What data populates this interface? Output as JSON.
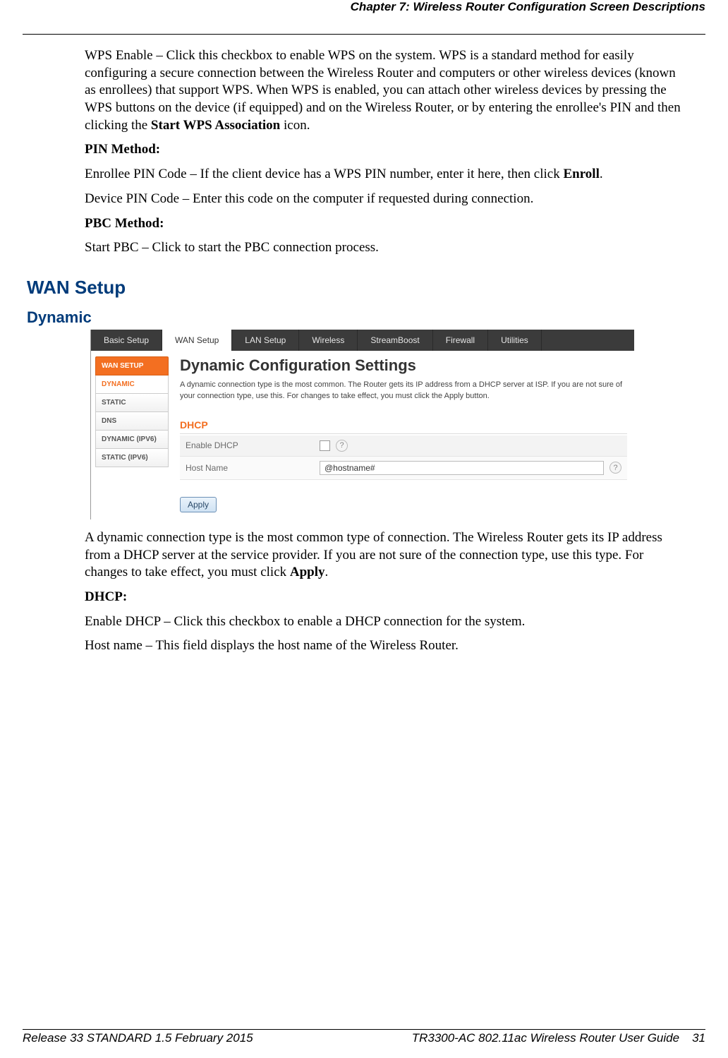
{
  "header": {
    "chapter_line": "Chapter 7: Wireless Router Configuration Screen Descriptions"
  },
  "body": {
    "p1_a": "WPS Enable – Click this checkbox to enable WPS on the system. WPS is a standard method for easily configuring a secure connection between the Wireless Router and computers or other wireless devices (known as enrollees) that support WPS. When WPS is enabled, you can attach other wireless devices by pressing the WPS buttons on the device (if equipped) and on the Wireless Router, or by entering the enrollee's PIN and then clicking the ",
    "p1_bold": "Start WPS Association",
    "p1_b": " icon.",
    "pin_method": "PIN Method:",
    "p2_a": "Enrollee PIN Code – If the client device has a WPS PIN number, enter it here, then click ",
    "p2_bold": "Enroll",
    "p2_b": ".",
    "p3": "Device PIN Code – Enter this code on the computer if requested during connection.",
    "pbc_method": "PBC Method:",
    "p4": "Start PBC – Click to start the PBC connection process.",
    "h2": "WAN Setup",
    "h3": "Dynamic",
    "p5_a": "A dynamic connection type is the most common type of connection. The Wireless Router gets its IP address from a DHCP server at the service provider. If you are not sure of the connection type, use this type. For changes to take effect, you must click ",
    "p5_bold": "Apply",
    "p5_b": ".",
    "dhcp_head": "DHCP:",
    "p6": "Enable DHCP – Click this checkbox to enable a DHCP connection for the system.",
    "p7": "Host name – This field displays the host name of the Wireless Router."
  },
  "screenshot": {
    "tabs": [
      "Basic Setup",
      "WAN Setup",
      "LAN Setup",
      "Wireless",
      "StreamBoost",
      "Firewall",
      "Utilities"
    ],
    "active_tab": "WAN Setup",
    "sidebar": {
      "title": "WAN SETUP",
      "items": [
        "DYNAMIC",
        "STATIC",
        "DNS",
        "DYNAMIC (IPV6)",
        "STATIC (IPV6)"
      ],
      "active": "DYNAMIC"
    },
    "title": "Dynamic Configuration Settings",
    "intro": "A dynamic connection type is the most common. The Router gets its IP address from a DHCP server at ISP. If you are not sure of your connection type, use this. For changes to take effect, you must click the Apply button.",
    "dhcp_label": "DHCP",
    "row1_label": "Enable DHCP",
    "row2_label": "Host Name",
    "row2_value": "@hostname#",
    "apply": "Apply"
  },
  "footer": {
    "left": "Release 33 STANDARD 1.5    February 2015",
    "right_title": "TR3300-AC 802.11ac Wireless Router User Guide",
    "page": "31"
  }
}
